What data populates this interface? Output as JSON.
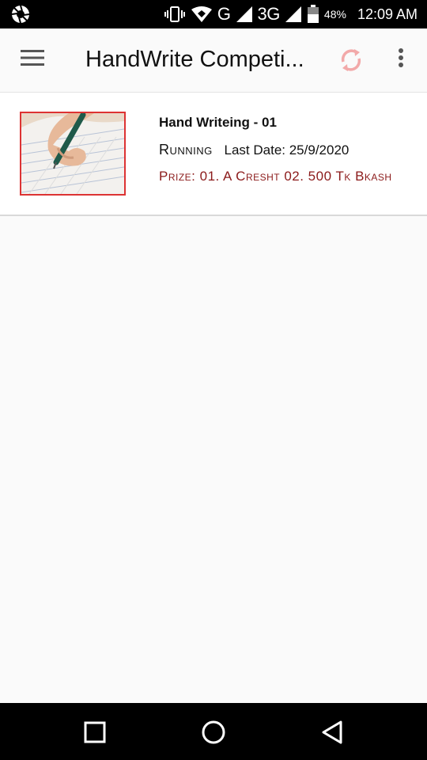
{
  "status_bar": {
    "network_type_1": "G",
    "network_type_2": "3G",
    "battery_percent": "48%",
    "time": "12:09 AM"
  },
  "app_bar": {
    "title": "HandWrite Competi...",
    "menu_icon": "hamburger-menu-icon",
    "sync_icon": "sync-icon",
    "more_icon": "more-vert-icon",
    "sync_color": "#f2a9a9"
  },
  "competitions": [
    {
      "title": "Hand Writeing - 01",
      "status": "Running",
      "last_date": "Last Date: 25/9/2020",
      "prize": "Prize: 01. A Cresht 02. 500 Tk Bkash",
      "thumbnail_icon": "handwriting-photo",
      "accent_color": "#8b1a1a"
    }
  ],
  "nav_bar": {
    "recents_icon": "square-icon",
    "home_icon": "circle-icon",
    "back_icon": "triangle-back-icon"
  }
}
